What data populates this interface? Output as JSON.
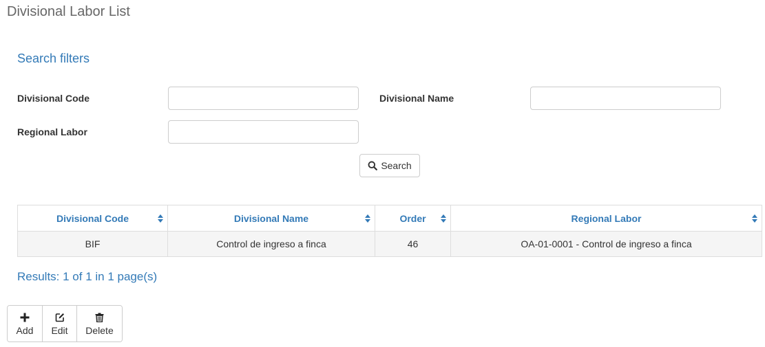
{
  "page": {
    "title": "Divisional Labor List"
  },
  "filters": {
    "title": "Search filters",
    "divisional_code": {
      "label": "Divisional Code",
      "value": "",
      "placeholder": ""
    },
    "divisional_name": {
      "label": "Divisional Name",
      "value": "",
      "placeholder": ""
    },
    "regional_labor": {
      "label": "Regional Labor",
      "value": "",
      "placeholder": ""
    },
    "search_label": "Search",
    "search_icon": "magnifier-icon"
  },
  "table": {
    "columns": [
      "Divisional Code",
      "Divisional Name",
      "Order",
      "Regional Labor"
    ],
    "sort_icon": "sort-icon",
    "rows": [
      [
        "BIF",
        "Control de ingreso a finca",
        "46",
        "OA-01-0001 - Control de ingreso a finca"
      ]
    ]
  },
  "results": {
    "text": "Results: 1 of 1 in 1 page(s)"
  },
  "toolbar": {
    "add": {
      "label": "Add",
      "icon": "plus-icon"
    },
    "edit": {
      "label": "Edit",
      "icon": "edit-icon"
    },
    "delete": {
      "label": "Delete",
      "icon": "trash-icon"
    }
  },
  "colors": {
    "accent": "#337ab7",
    "title": "#666666",
    "row_bg": "#f5f5f5",
    "border": "#dddddd"
  }
}
